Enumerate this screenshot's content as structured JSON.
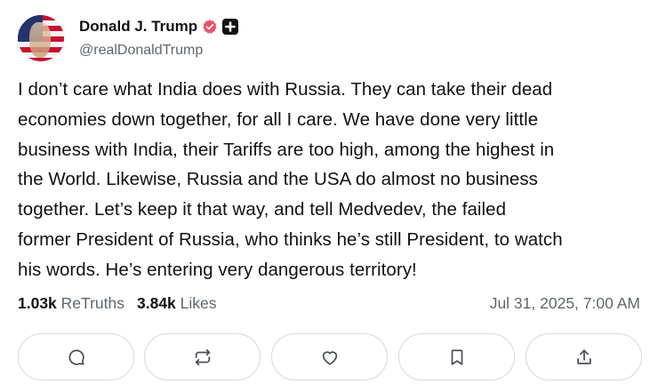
{
  "author": {
    "display_name": "Donald J. Trump",
    "handle": "@realDonaldTrump",
    "verified_badge_color": "#e8526b"
  },
  "post": {
    "lines": [
      "I don’t care what India does with Russia. They can take their dead",
      "economies down together, for all I care. We have done very little",
      "business with India, their Tariffs are too high, among the highest in",
      "the World. Likewise, Russia and the USA do almost no business",
      "together. Let’s keep it that way, and tell Medvedev, the failed",
      "former President of Russia, who thinks he’s still President, to watch",
      "his words. He’s entering very dangerous territory!"
    ]
  },
  "stats": {
    "retruths_count": "1.03k",
    "retruths_label": "ReTruths",
    "likes_count": "3.84k",
    "likes_label": "Likes",
    "timestamp": "Jul 31, 2025, 7:00 AM"
  },
  "actions": [
    {
      "icon": "reply-icon"
    },
    {
      "icon": "retruth-icon"
    },
    {
      "icon": "like-icon"
    },
    {
      "icon": "bookmark-icon"
    },
    {
      "icon": "share-icon"
    }
  ]
}
